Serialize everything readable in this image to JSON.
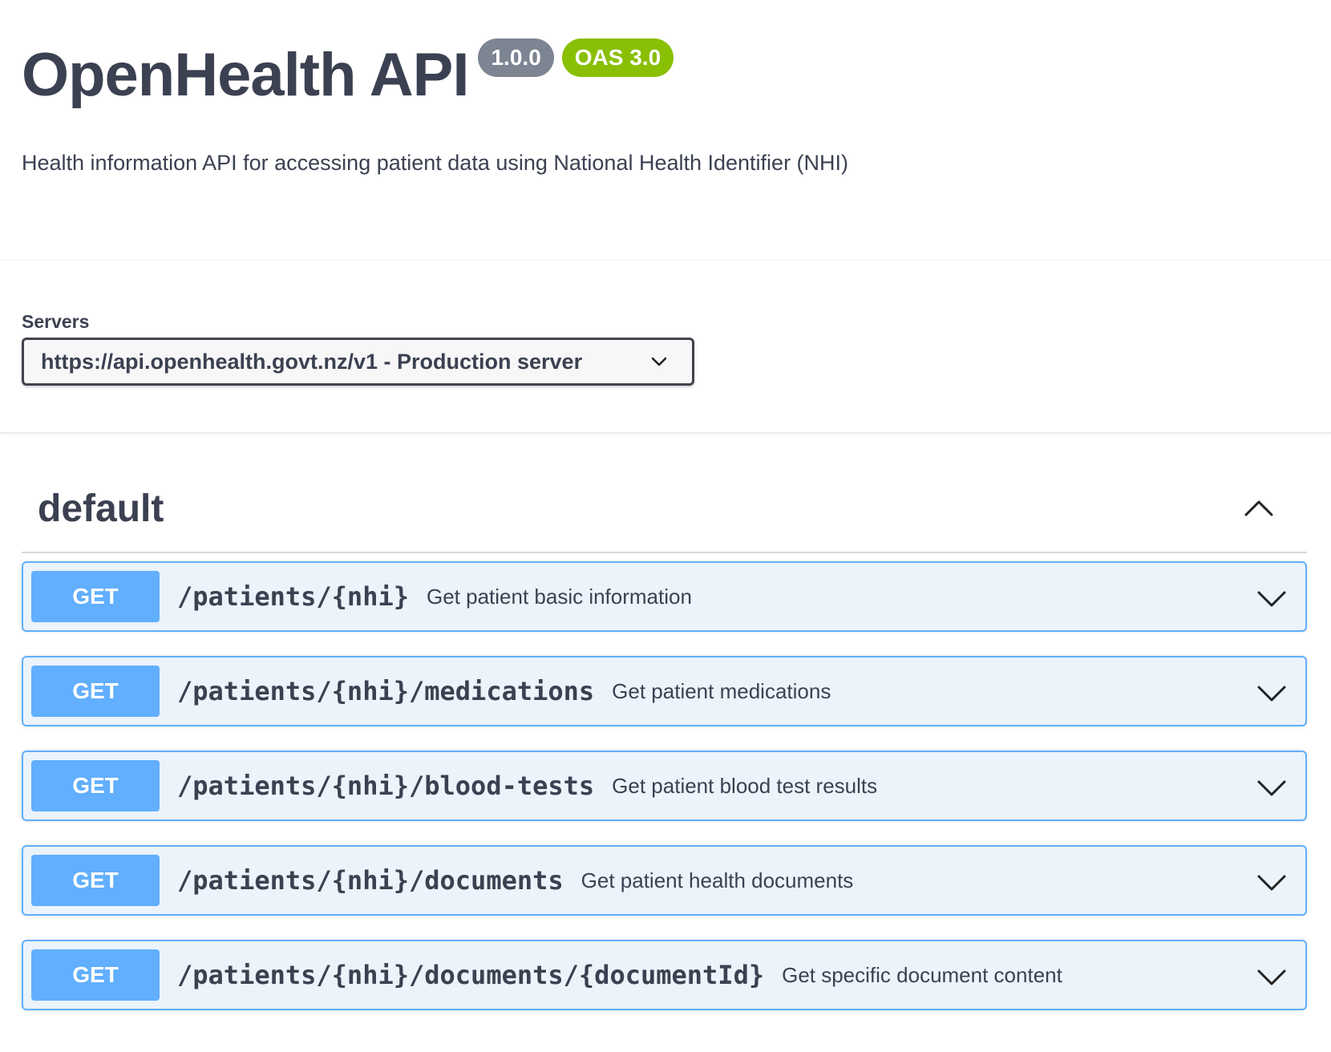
{
  "info": {
    "title": "OpenHealth API",
    "version": "1.0.0",
    "oas_version": "OAS 3.0",
    "description": "Health information API for accessing patient data using National Health Identifier (NHI)"
  },
  "servers": {
    "label": "Servers",
    "selected": "https://api.openhealth.govt.nz/v1 - Production server"
  },
  "tag": {
    "name": "default",
    "expanded": true
  },
  "operations": [
    {
      "method": "GET",
      "path": "/patients/{nhi}",
      "summary": "Get patient basic information"
    },
    {
      "method": "GET",
      "path": "/patients/{nhi}/medications",
      "summary": "Get patient medications"
    },
    {
      "method": "GET",
      "path": "/patients/{nhi}/blood-tests",
      "summary": "Get patient blood test results"
    },
    {
      "method": "GET",
      "path": "/patients/{nhi}/documents",
      "summary": "Get patient health documents"
    },
    {
      "method": "GET",
      "path": "/patients/{nhi}/documents/{documentId}",
      "summary": "Get specific document content"
    }
  ],
  "colors": {
    "get_method": "#61affe",
    "get_background": "#ebf3fb",
    "version_badge": "#7d8492",
    "oas_badge": "#89bf04",
    "text": "#3b4151"
  },
  "icons": {
    "server_dropdown": "chevron-down-icon",
    "tag_toggle": "chevron-up-icon",
    "operation_toggle": "chevron-down-icon"
  }
}
